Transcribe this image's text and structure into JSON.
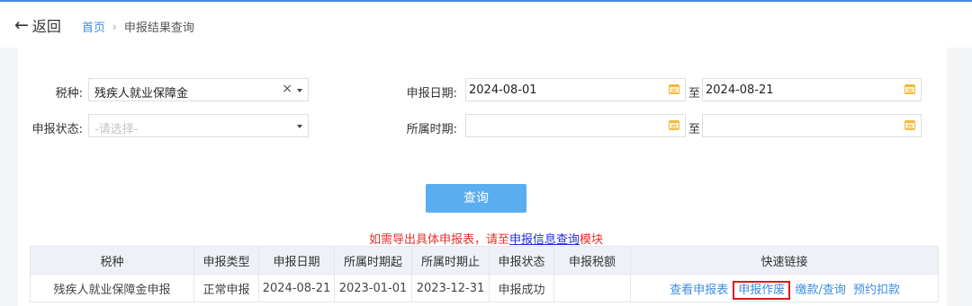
{
  "header": {
    "back_label": "返回",
    "breadcrumb": {
      "home": "首页",
      "separator": "›",
      "current": "申报结果查询"
    }
  },
  "form": {
    "tax_type": {
      "label": "税种:",
      "value": "残疾人就业保障金"
    },
    "status": {
      "label": "申报状态:",
      "placeholder": "-请选择-"
    },
    "declare_date": {
      "label": "申报日期:",
      "from": "2024-08-01",
      "to_label": "至",
      "to": "2024-08-21"
    },
    "period": {
      "label": "所属时期:",
      "from": "",
      "to_label": "至",
      "to": ""
    }
  },
  "query_button": "查询",
  "notice": {
    "before": "如需导出具体申报表，请至",
    "link": "申报信息查询",
    "after": "模块"
  },
  "table": {
    "headers": [
      "税种",
      "申报类型",
      "申报日期",
      "所属时期起",
      "所属时期止",
      "申报状态",
      "申报税额",
      "快速链接"
    ],
    "rows": [
      {
        "tax": "残疾人就业保障金申报",
        "type": "正常申报",
        "date": "2024-08-21",
        "period_start": "2023-01-01",
        "period_end": "2023-12-31",
        "status": "申报成功",
        "amount": "",
        "links": [
          "查看申报表",
          "申报作废",
          "缴款/查询",
          "预约扣款"
        ]
      }
    ]
  },
  "colors": {
    "accent": "#3c8dde",
    "button": "#5aaef0",
    "notice": "#e4312b",
    "highlight": "#e3171b"
  }
}
